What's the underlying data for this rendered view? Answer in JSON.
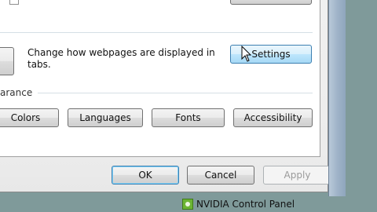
{
  "tabs_section": {
    "description": "Change how webpages are displayed in tabs.",
    "description_line1": "Change how webpages are displayed in",
    "description_line2": "tabs.",
    "settings_label": "Settings"
  },
  "appearance": {
    "group_label": "arance",
    "buttons": [
      "Colors",
      "Languages",
      "Fonts",
      "Accessibility"
    ]
  },
  "footer": {
    "ok_label": "OK",
    "cancel_label": "Cancel",
    "apply_label": "Apply"
  },
  "taskbar": {
    "item_label": "NVIDIA Control Panel",
    "icon": "nvidia-icon"
  }
}
